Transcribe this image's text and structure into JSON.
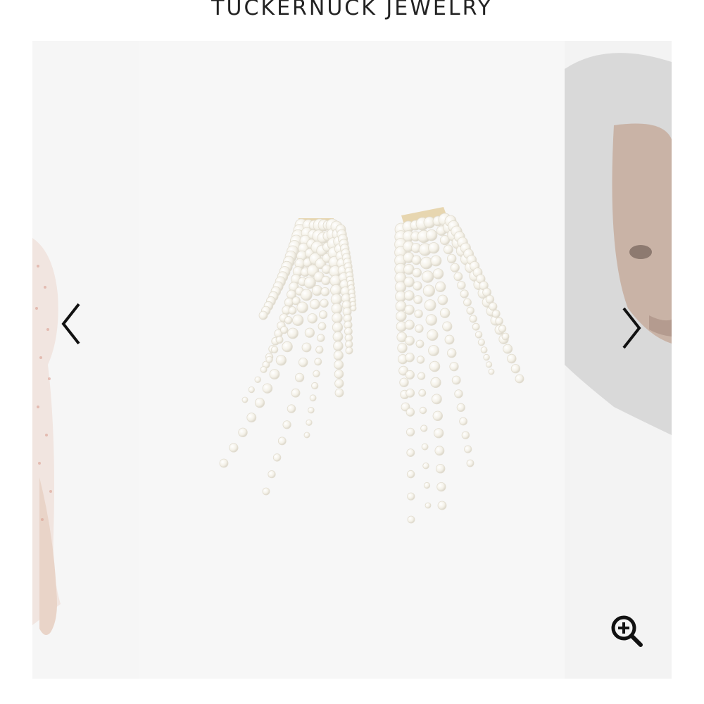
{
  "header": {
    "brand": "TUCKERNUCK JEWELRY"
  },
  "carousel": {
    "slides": [
      {
        "name": "model-outfit-preview",
        "position": "previous"
      },
      {
        "name": "pearl-tassel-earrings",
        "position": "current"
      },
      {
        "name": "model-wearing-earrings-preview",
        "position": "next"
      }
    ],
    "controls": {
      "prev_icon": "chevron-left-icon",
      "next_icon": "chevron-right-icon",
      "zoom_icon": "zoom-in-icon"
    }
  },
  "colors": {
    "pearl": "#f4f1e8",
    "gold": "#e7d6b0",
    "icon": "#111111"
  }
}
